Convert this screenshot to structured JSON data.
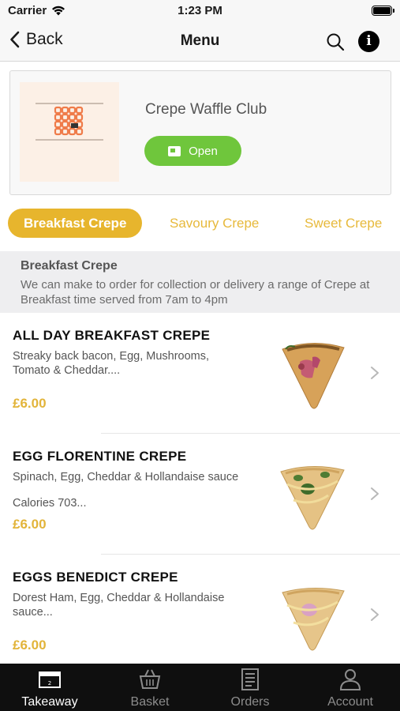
{
  "status_bar": {
    "carrier": "Carrier",
    "time": "1:23 PM"
  },
  "nav": {
    "back_label": "Back",
    "title": "Menu"
  },
  "shop": {
    "name": "Crepe Waffle Club",
    "status_label": "Open"
  },
  "categories": [
    {
      "label": "Breakfast Crepe",
      "active": true
    },
    {
      "label": "Savoury Crepe",
      "active": false
    },
    {
      "label": "Sweet Crepe",
      "active": false
    }
  ],
  "section": {
    "title": "Breakfast Crepe",
    "description": "We can make to order for collection or delivery a range of Crepe at Breakfast time served from 7am to 4pm"
  },
  "menu_items": [
    {
      "name": "ALL DAY BREAKFAST CREPE",
      "description": "Streaky back bacon, Egg, Mushrooms, Tomato & Cheddar....",
      "extra": "",
      "price": "£6.00"
    },
    {
      "name": "EGG FLORENTINE CREPE",
      "description": "Spinach, Egg, Cheddar & Hollandaise sauce",
      "extra": "Calories 703...",
      "price": "£6.00"
    },
    {
      "name": "EGGS BENEDICT CREPE",
      "description": "Dorest Ham, Egg, Cheddar & Hollandaise sauce...",
      "extra": "",
      "price": "£6.00"
    }
  ],
  "tab_bar": [
    {
      "label": "Takeaway",
      "icon": "takeaway-icon",
      "active": true
    },
    {
      "label": "Basket",
      "icon": "basket-icon",
      "active": false
    },
    {
      "label": "Orders",
      "icon": "orders-icon",
      "active": false
    },
    {
      "label": "Account",
      "icon": "account-icon",
      "active": false
    }
  ],
  "colors": {
    "accent": "#e7b52d",
    "open_green": "#6fc63c",
    "price": "#e2b43a",
    "tab_bar_bg": "#0f0f0f"
  }
}
